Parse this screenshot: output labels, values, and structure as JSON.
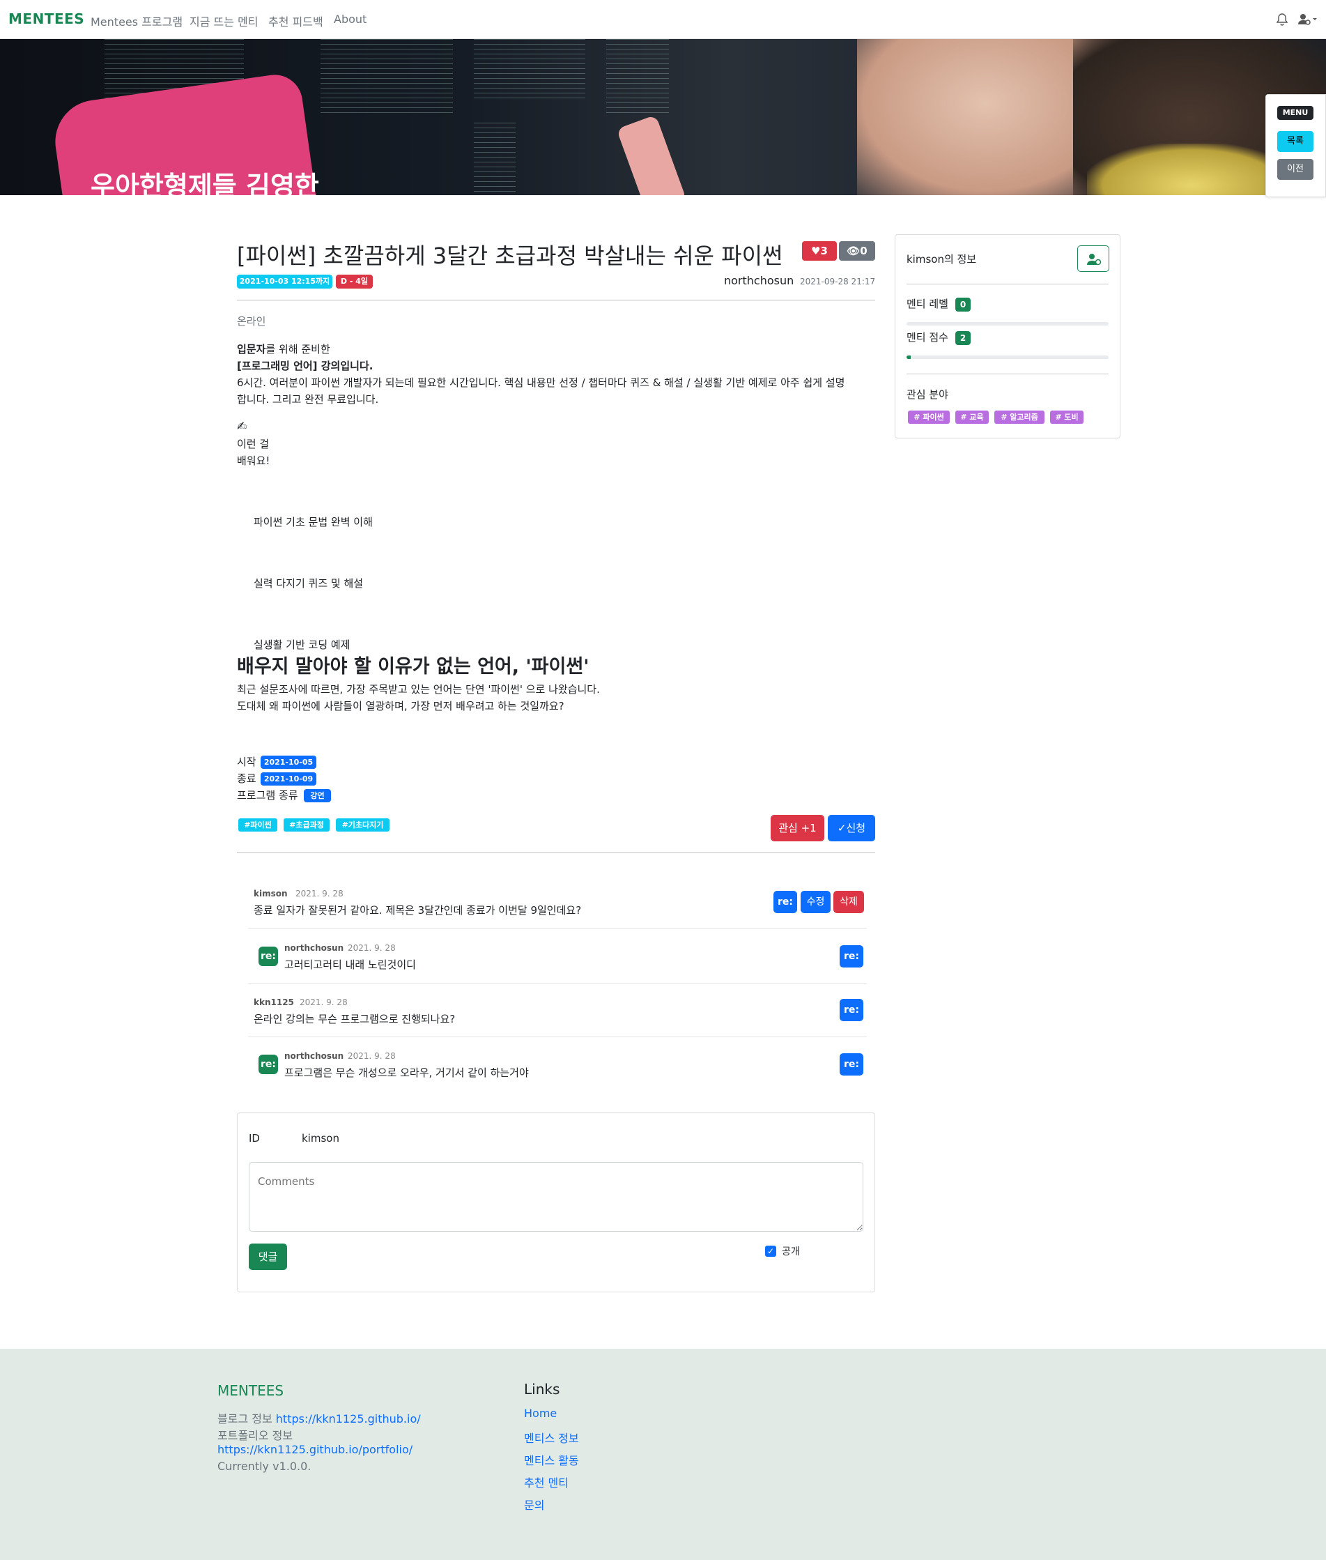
{
  "nav": {
    "brand": "MENTEES",
    "links": [
      "Mentees 프로그램",
      "지금 뜨는 멘티",
      "추천 피드백",
      "About"
    ]
  },
  "hero": {
    "text": "우아한형제들 김영한"
  },
  "side_menu": {
    "title": "MENU",
    "list_label": "목록",
    "prev_label": "이전"
  },
  "post": {
    "title": "[파이썬] 초깔끔하게 3달간 초급과정 박살내는 쉬운 파이썬",
    "likes": "3",
    "views": "0",
    "deadline": "2021-10-03 12:15까지",
    "dday": "D - 4일",
    "author": "northchosun",
    "posted": "2021-09-28 21:17",
    "mode": "온라인",
    "intro_bold1": "입문자",
    "intro_rest1": "를 위해 준비한",
    "intro_bold2": "[프로그래밍 언어] 강의입니다.",
    "desc_line1": "6시간. 여러분이 파이썬 개발자가 되는데 필요한 시간입니다. 핵심 내용만 선정 / 챕터마다 퀴즈 & 해설 / 실생활 기반 예제로 아주 쉽게 설명",
    "desc_line2": "합니다. 그리고 완전 무료입니다.",
    "emoji": "✍",
    "learn1": "이런 걸",
    "learn2": "배워요!",
    "items": [
      "파이썬 기초 문법 완벽 이해",
      "실력 다지기 퀴즈 및 해설",
      "실생활 기반 코딩 예제"
    ],
    "heading": "배우지 말아야 할 이유가 없는 언어, '파이썬'",
    "para1": "최근 설문조사에 따르면, 가장 주목받고 있는 언어는 단연 '파이썬' 으로 나왔습니다.",
    "para2": "도대체 왜 파이썬에 사람들이 열광하며, 가장 먼저 배우려고 하는 것일까요?",
    "start_label": "시작",
    "start": "2021-10-05",
    "end_label": "종료",
    "end": "2021-10-09",
    "type_label": "프로그램 종류",
    "type": "강연",
    "tags": [
      "#파이썬",
      "#초급과정",
      "#기초다지기"
    ],
    "interest_btn": "관심 +1",
    "apply_btn": "✓신청"
  },
  "profile": {
    "title": "kimson의 정보",
    "level_label": "멘티 레벨",
    "level": "0",
    "score_label": "멘티 점수",
    "score": "2",
    "score_fraction": 0.02,
    "interest_label": "관심 분야",
    "interests": [
      "# 파이썬",
      "# 교육",
      "# 알고리즘",
      "# 도비"
    ]
  },
  "comments": [
    {
      "user": "kimson",
      "date": "2021. 9. 28",
      "text": "종료 일자가 잘못된거 같아요. 제목은 3달간인데 종료가 이번달 9일인데요?",
      "reply": false
    },
    {
      "user": "northchosun",
      "date": "2021. 9. 28",
      "text": "고러티고러티 내래 노린것이디",
      "reply": true
    },
    {
      "user": "kkn1125",
      "date": "2021. 9. 28",
      "text": "온라인 강의는 무슨 프로그램으로 진행되나요?",
      "reply": false
    },
    {
      "user": "northchosun",
      "date": "2021. 9. 28",
      "text": "프로그램은 무슨 개성으로 오라우, 거기서 같이 하는거야",
      "reply": true
    }
  ],
  "comment_buttons": {
    "re": "re:",
    "edit": "수정",
    "delete": "삭제"
  },
  "comment_form": {
    "id_label": "ID",
    "id_value": "kimson",
    "placeholder": "Comments",
    "public_label": "공개",
    "submit": "댓글"
  },
  "footer": {
    "brand": "MENTEES",
    "blog_label": "블로그 정보",
    "blog_url": "https://kkn1125.github.io/",
    "portfolio_label": "포트폴리오 정보",
    "portfolio_url": "https://kkn1125.github.io/portfolio/",
    "version": "Currently v1.0.0.",
    "links_title": "Links",
    "links": [
      "Home",
      "멘티스 정보",
      "멘티스 활동",
      "추천 멘티",
      "문의"
    ]
  },
  "colors": {
    "brand_green": "#198754",
    "primary": "#0d6efd",
    "danger": "#dc3545",
    "info": "#0dcaf0",
    "tag_purple": "#b86ee0"
  }
}
